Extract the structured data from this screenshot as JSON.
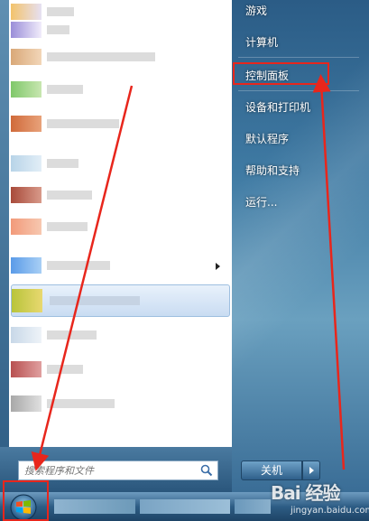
{
  "right_menu": {
    "items": [
      {
        "label": "游戏"
      },
      {
        "label": "计算机"
      },
      {
        "label": "控制面板"
      },
      {
        "label": "设备和打印机"
      },
      {
        "label": "默认程序"
      },
      {
        "label": "帮助和支持"
      },
      {
        "label": "运行..."
      }
    ],
    "highlighted_item": "控制面板"
  },
  "search": {
    "placeholder": "搜索程序和文件",
    "value": ""
  },
  "shutdown": {
    "label": "关机"
  },
  "watermark": {
    "logo": "Bai 经验",
    "url": "jingyan.baidu.com"
  },
  "colors": {
    "highlight_red": "#e8261c",
    "menu_blue": "#2b5c86",
    "text_white": "#ffffff"
  },
  "icons": [
    "search-icon",
    "windows-logo-icon",
    "chevron-right-icon"
  ]
}
